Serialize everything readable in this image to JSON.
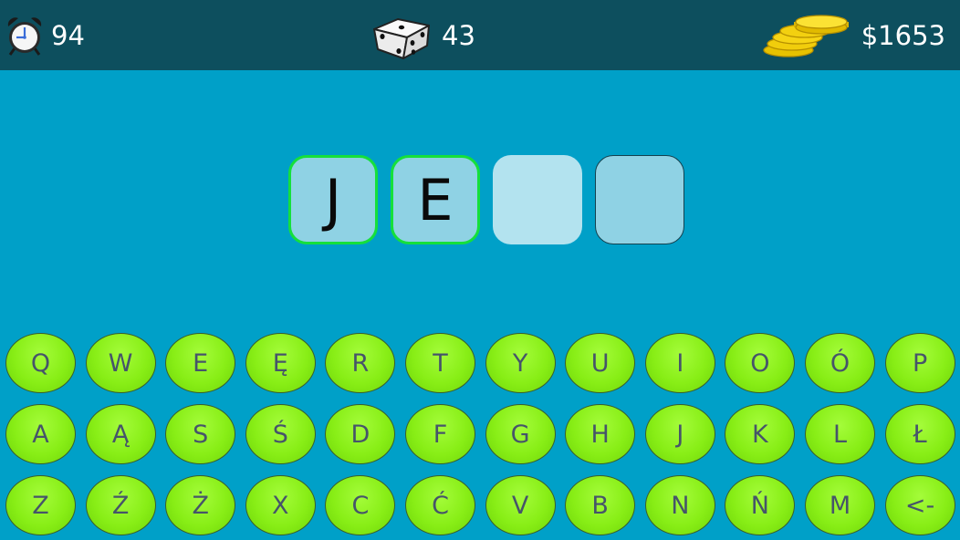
{
  "status": {
    "timer": {
      "icon": "alarm-clock-icon",
      "value": "94"
    },
    "dice": {
      "icon": "dice-icon",
      "value": "43"
    },
    "money": {
      "icon": "gold-coins-icon",
      "value": "$1653"
    }
  },
  "word_slots": [
    {
      "letter": "J",
      "state": "filled"
    },
    {
      "letter": "E",
      "state": "filled"
    },
    {
      "letter": "",
      "state": "active"
    },
    {
      "letter": "",
      "state": "empty"
    }
  ],
  "keyboard": {
    "rows": [
      [
        "Q",
        "W",
        "E",
        "Ę",
        "R",
        "T",
        "Y",
        "U",
        "I",
        "O",
        "Ó",
        "P"
      ],
      [
        "A",
        "Ą",
        "S",
        "Ś",
        "D",
        "F",
        "G",
        "H",
        "J",
        "K",
        "L",
        "Ł"
      ],
      [
        "Z",
        "Ź",
        "Ż",
        "X",
        "C",
        "Ć",
        "V",
        "B",
        "N",
        "Ń",
        "M",
        "<-"
      ]
    ]
  },
  "colors": {
    "background": "#00a0c8",
    "topbar": "#0d4f5e",
    "key_green": "#88ee16",
    "key_text": "#46546a",
    "slot_border_filled": "#15e03b"
  }
}
